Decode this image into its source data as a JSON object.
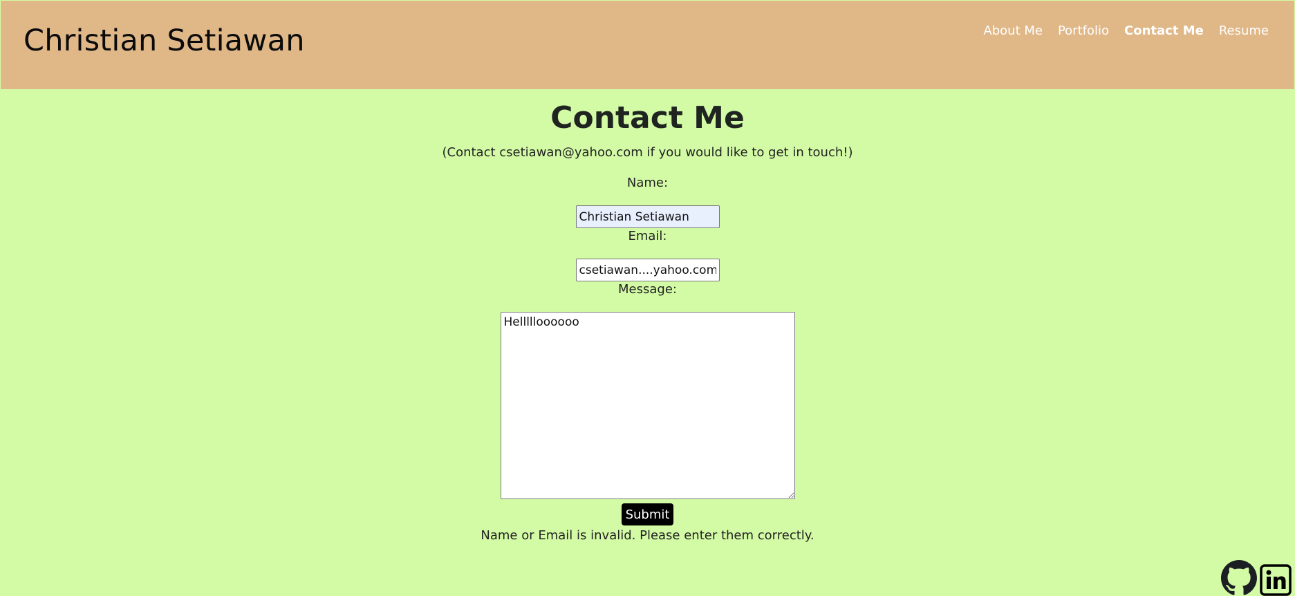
{
  "header": {
    "site_title": "Christian Setiawan",
    "nav": [
      {
        "label": "About Me",
        "active": false
      },
      {
        "label": "Portfolio",
        "active": false
      },
      {
        "label": "Contact Me",
        "active": true
      },
      {
        "label": "Resume",
        "active": false
      }
    ]
  },
  "contact": {
    "heading": "Contact Me",
    "subtitle": "(Contact csetiawan@yahoo.com if you would like to get in touch!)",
    "name_label": "Name:",
    "name_value": "Christian Setiawan",
    "email_label": "Email:",
    "email_value": "csetiawan....yahoo.com",
    "message_label": "Message:",
    "message_value": "Hellllloooooo",
    "submit_label": "Submit",
    "error_text": "Name or Email is invalid. Please enter them correctly."
  },
  "social": {
    "icons": [
      "github-icon",
      "linkedin-icon"
    ]
  },
  "colors": {
    "page_background": "#d3fba5",
    "header_background": "#e0b787",
    "nav_text": "#ffffff",
    "button_background": "#000000"
  }
}
